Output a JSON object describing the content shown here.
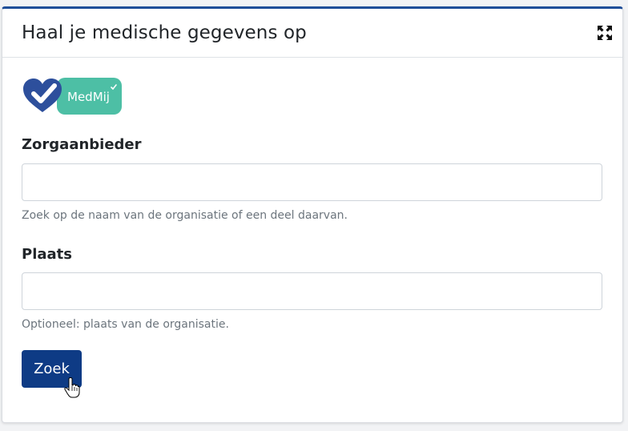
{
  "dialog": {
    "title": "Haal je medische gegevens op",
    "expand_icon": "expand-arrows-icon"
  },
  "logo": {
    "text": "MedMij",
    "colors": {
      "heart": "#2d4f9c",
      "badge": "#4dbfa5"
    }
  },
  "form": {
    "provider_label": "Zorgaanbieder",
    "provider_value": "",
    "provider_help": "Zoek op de naam van de organisatie of een deel daarvan.",
    "city_label": "Plaats",
    "city_value": "",
    "city_help": "Optioneel: plaats van de organisatie.",
    "search_button": "Zoek"
  },
  "colors": {
    "primary": "#0e3b85",
    "header_border": "#1f4e99",
    "muted_text": "#6c757d"
  }
}
